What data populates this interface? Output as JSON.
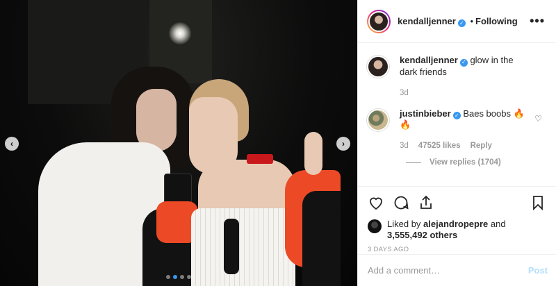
{
  "post": {
    "author": "kendalljenner",
    "follow_status": "Following",
    "separator": "•",
    "more_glyph": "•••",
    "verified_glyph": "✓",
    "caption": "glow in the dark friends",
    "caption_time": "3d",
    "nav_prev": "‹",
    "nav_next": "›",
    "carousel_dots": 4,
    "carousel_active": 1
  },
  "comments": [
    {
      "user": "justinbieber",
      "text": "Baes boobs",
      "emoji": "🔥",
      "emoji2": "🔥",
      "time": "3d",
      "likes": "47525 likes",
      "reply_label": "Reply",
      "heart_glyph": "♡",
      "view_replies": "View replies (1704)"
    }
  ],
  "likes": {
    "prefix": "Liked by",
    "user": "alejandropepre",
    "conj": "and",
    "others": "3,555,492 others"
  },
  "time_ago": "3 DAYS AGO",
  "composer": {
    "placeholder": "Add a comment…",
    "post_label": "Post"
  },
  "colors": {
    "accent": "#3897f0",
    "post_disabled": "#b2dffc",
    "muted": "#999999",
    "text": "#262626"
  },
  "icons": [
    "heart-icon",
    "comment-icon",
    "share-icon",
    "bookmark-icon",
    "verified-icon",
    "more-icon",
    "chevron-left-icon",
    "chevron-right-icon"
  ]
}
